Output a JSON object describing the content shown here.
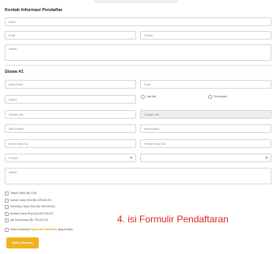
{
  "contact": {
    "title": "Kontak Informasi Pendaftar",
    "name_ph": "Nama",
    "email_ph": "Email",
    "phone_ph": "Telepon",
    "address_ph": "Alamat"
  },
  "student": {
    "title": "Siswa #1",
    "fullname_ph": "Nama Siswa",
    "email_ph": "Email",
    "religion_ph": "Agama",
    "gender": {
      "male": "Laki-laki",
      "female": "Perempuan"
    },
    "birthplace_ph": "Tempat Lahir",
    "birthdate_ph": "Tanggal Lahir",
    "origin_ph": "Asal Sekolah",
    "cert_ph": "Nomor Ijazah",
    "parent_name_ph": "Nama Orang Tua",
    "parent_phone_ph": "Telepon Orang Tua",
    "province_ph": "Provinsi",
    "city_ph": "",
    "address_ph": "Alamat"
  },
  "camps": [
    "Tanpa Camp (Rp 0,00)",
    "Kamar Camp Girls (Rp 325.000,00)",
    "Dormitory Camp Girls (Rp 425.000,00)",
    "Asrama Camp Boys (Rp 325.000,00)",
    "Apt Camp Boys (Rp 750.000,00)"
  ],
  "agree": {
    "prefix": "Saya menyetujui ",
    "link": "Syarat dan Ketentuan",
    "suffix": " yang berlaku"
  },
  "submit_label": "Daftar Sekarang",
  "caption": "4. isi Formulir Pendaftaran",
  "colors": {
    "accent": "#f0b21e",
    "caption": "#e0231f"
  }
}
